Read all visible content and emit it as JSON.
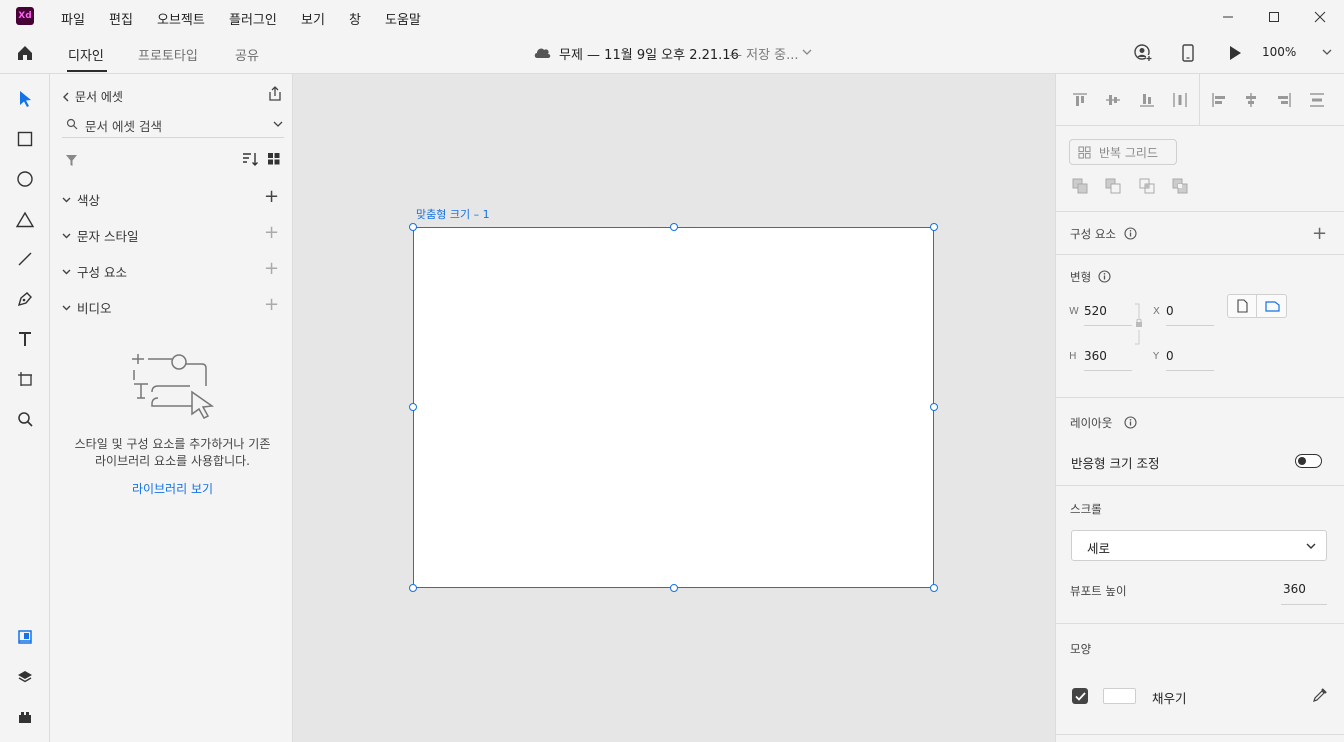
{
  "app": {
    "logo_text": "Xd"
  },
  "menu": [
    "파일",
    "편집",
    "오브젝트",
    "플러그인",
    "보기",
    "창",
    "도움말"
  ],
  "tabs": {
    "design": "디자인",
    "prototype": "프로토타입",
    "share": "공유"
  },
  "document": {
    "title": "무제 — 11월 9일 오후 2.21.16",
    "status": "— 저장 중..."
  },
  "zoom": "100%",
  "assets": {
    "back_label": "문서 에셋",
    "search_placeholder": "문서 에셋 검색",
    "sections": {
      "colors": "색상",
      "char_styles": "문자 스타일",
      "components": "구성 요소",
      "video": "비디오"
    },
    "empty_text_line1": "스타일 및 구성 요소를 추가하거나 기존",
    "empty_text_line2": "라이브러리 요소를 사용합니다.",
    "library_link": "라이브러리 보기"
  },
  "canvas": {
    "artboard_label": "맞춤형 크기 – 1"
  },
  "inspector": {
    "repeat_grid": "반복 그리드",
    "components": "구성 요소",
    "transform": "변형",
    "w_label": "W",
    "w_value": "520",
    "x_label": "X",
    "x_value": "0",
    "h_label": "H",
    "h_value": "360",
    "y_label": "Y",
    "y_value": "0",
    "layout": "레이아웃",
    "responsive_resize": "반응형 크기 조정",
    "scroll": "스크롤",
    "scroll_value": "세로",
    "viewport_height_label": "뷰포트 높이",
    "viewport_height_value": "360",
    "appearance": "모양",
    "fill_label": "채우기"
  },
  "colors": {
    "accent": "#1473e6",
    "panel": "#f4f4f4",
    "canvas": "#e6e6e6",
    "logo_bg": "#470137",
    "logo_fg": "#ff61f6"
  }
}
